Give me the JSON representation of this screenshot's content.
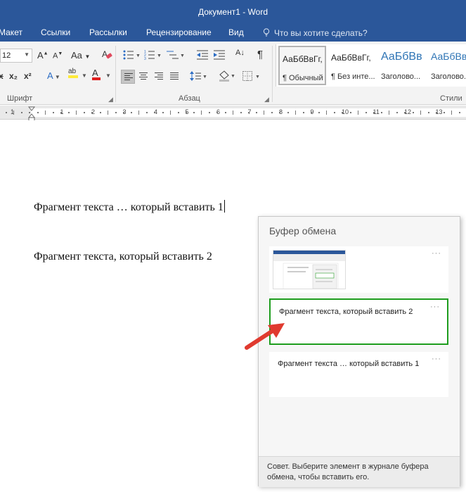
{
  "window": {
    "title": "Документ1 - Word"
  },
  "menu": {
    "tabs": [
      "Макет",
      "Ссылки",
      "Рассылки",
      "Рецензирование",
      "Вид"
    ],
    "tell_me": "Что вы хотите сделать?"
  },
  "ribbon": {
    "font_size": "12",
    "change_case": "Aa",
    "highlight_letters": "ab",
    "font_color_letter": "A",
    "text_effects_letter": "A",
    "subscript": "x₂",
    "superscript": "x²",
    "strikethrough": "x",
    "pilcrow": "¶",
    "sort": "A↓",
    "groups": {
      "font": "Шрифт",
      "paragraph": "Абзац",
      "styles": "Стили"
    },
    "styles": [
      {
        "sample": "АаБбВвГг,",
        "name": "¶ Обычный"
      },
      {
        "sample": "АаБбВвГг,",
        "name": "¶ Без инте..."
      },
      {
        "sample": "АаБбВв",
        "name": "Заголово..."
      },
      {
        "sample": "АаБбВв",
        "name": "Заголово..."
      }
    ]
  },
  "ruler": {
    "labels": [
      "1",
      "1",
      "2",
      "3",
      "4",
      "5",
      "6",
      "7",
      "8",
      "9",
      "10",
      "11",
      "12",
      "13"
    ]
  },
  "document": {
    "lines": [
      "Фрагмент текста … который вставить 1",
      "Фрагмент текста, который вставить 2"
    ]
  },
  "clipboard": {
    "title": "Буфер обмена",
    "more": "···",
    "items": [
      {
        "type": "image",
        "text": ""
      },
      {
        "type": "text",
        "text": "Фрагмент текста, который вставить 2"
      },
      {
        "type": "text",
        "text": "Фрагмент текста … который вставить 1"
      }
    ],
    "tip": "Совет. Выберите элемент в журнале буфера обмена, чтобы вставить его."
  },
  "colors": {
    "title_bar": "#2b579a",
    "selected_item_border": "#1e9d1e",
    "arrow": "#e03a2f",
    "heading_style": "#2e74b5"
  }
}
